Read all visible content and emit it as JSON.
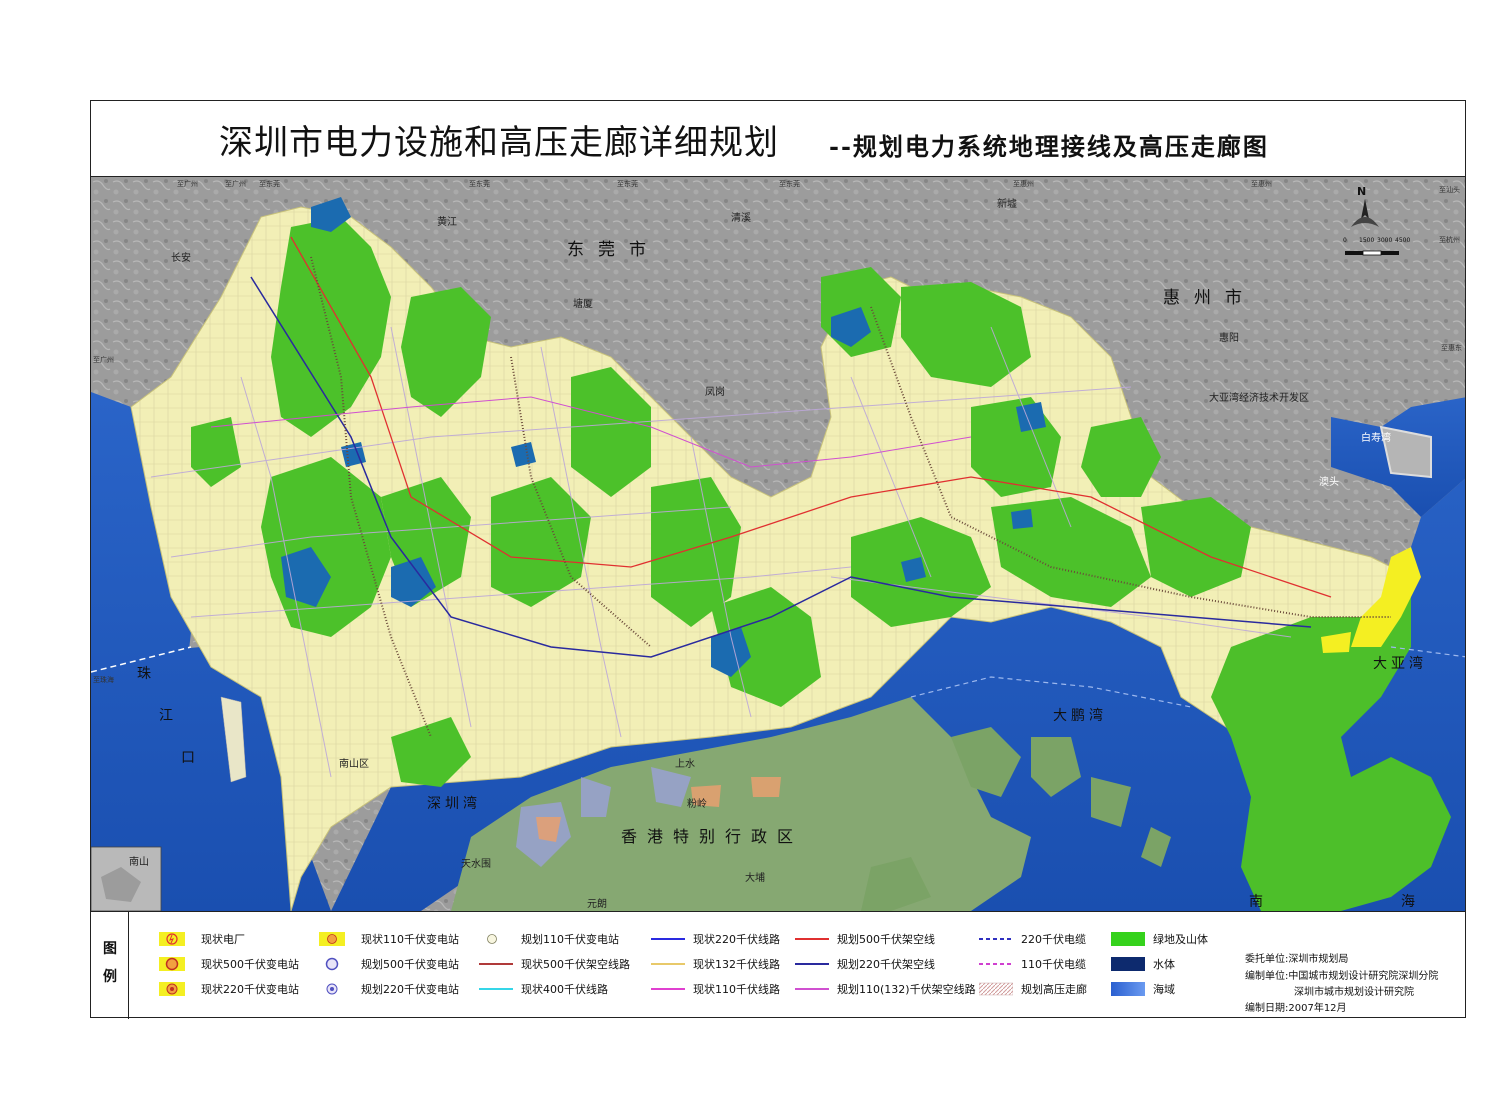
{
  "title": {
    "main": "深圳市电力设施和高压走廊详细规划",
    "sub": "--规划电力系统地理接线及高压走廊图"
  },
  "map": {
    "north_label": "N",
    "scale_labels": [
      "0",
      "1500",
      "3000",
      "4500"
    ],
    "colors": {
      "sea": "#1f5fc8",
      "land_grey": "#9a9a9a",
      "urban": "#f2efb6",
      "green": "#4dbf2a",
      "green_bright": "#35d21c",
      "water": "#1b6bb0",
      "hongkong": "#7da36a",
      "power_yellow": "#f4ef22"
    },
    "places": {
      "dongguan": "东莞市",
      "huizhou": "惠州市",
      "hongkong": "香港特别行政区",
      "zhu": "珠",
      "jiang": "江",
      "kou": "口",
      "shenzhen_bay": "深圳湾",
      "dapeng_bay": "大鹏湾",
      "daya_bay": "大亚湾",
      "nan": "南",
      "hai": "海",
      "huangjiang": "黄江",
      "qingxi": "清溪",
      "tangxia": "塘厦",
      "fenggang": "凤岗",
      "chang_an": "长安",
      "xinxu": "新墟",
      "huiyang": "惠阳",
      "daya_dev": "大亚湾经济技术开发区",
      "shangshui": "上水",
      "fenling": "粉岭",
      "tianshuiwei": "天水围",
      "yuanlang": "元朗",
      "dabu": "大埔",
      "nanshan": "南山",
      "baishou": "白寿湾",
      "ao_tou": "澳头",
      "nanshan_district": "南山区"
    },
    "road_tags": {
      "zhi_guangzhou_1": "至广州",
      "zhi_guangzhou_2": "至广州",
      "zhi_dongguan_1": "至东莞",
      "zhi_dongguan_2": "至东莞",
      "zhi_dongguan_3": "至东莞",
      "zhi_dongguan_4": "至东莞",
      "zhi_huizhou_1": "至惠州",
      "zhi_huizhou_2": "至惠州",
      "zhi_shantou": "至汕头",
      "zhi_hangzhou": "至杭州",
      "zhi_pingdong": "至惠东",
      "zhi_guangzhou_3": "至广州",
      "zhi_zhuhai": "至珠海"
    }
  },
  "legend": {
    "heading": [
      "图",
      "例"
    ],
    "items": [
      {
        "label": "现状电厂",
        "symbol": "plant"
      },
      {
        "label": "现状500千伏变电站",
        "symbol": "sub-existing-500"
      },
      {
        "label": "现状220千伏变电站",
        "symbol": "sub-existing-220"
      },
      {
        "label": "现状110千伏变电站",
        "symbol": "sub-existing-110"
      },
      {
        "label": "规划500千伏变电站",
        "symbol": "sub-planned-500"
      },
      {
        "label": "规划220千伏变电站",
        "symbol": "sub-planned-220"
      },
      {
        "label": "规划110千伏变电站",
        "symbol": "sub-planned-110"
      },
      {
        "label": "现状500千伏架空线路",
        "symbol": "line",
        "color": "#b03a3a",
        "style": "solid"
      },
      {
        "label": "现状400千伏线路",
        "symbol": "line",
        "color": "#35d6e8",
        "style": "solid"
      },
      {
        "label": "现状220千伏线路",
        "symbol": "line",
        "color": "#2a2ae0",
        "style": "solid"
      },
      {
        "label": "现状132千伏线路",
        "symbol": "line",
        "color": "#e8c96a",
        "style": "solid"
      },
      {
        "label": "现状110千伏线路",
        "symbol": "line",
        "color": "#e040d0",
        "style": "solid"
      },
      {
        "label": "规划500千伏架空线",
        "symbol": "line",
        "color": "#e03030",
        "style": "solid"
      },
      {
        "label": "规划220千伏架空线",
        "symbol": "line",
        "color": "#2a2a9e",
        "style": "solid"
      },
      {
        "label": "规划110(132)千伏架空线路",
        "symbol": "line",
        "color": "#d050d0",
        "style": "solid"
      },
      {
        "label": "220千伏电缆",
        "symbol": "line",
        "color": "#3030c0",
        "style": "dashed"
      },
      {
        "label": "110千伏电缆",
        "symbol": "line",
        "color": "#d040d0",
        "style": "dashed"
      },
      {
        "label": "规划高压走廊",
        "symbol": "corridor"
      },
      {
        "label": "绿地及山体",
        "symbol": "fill",
        "color": "#35d21c"
      },
      {
        "label": "水体",
        "symbol": "fill",
        "color": "#0d2a6e"
      },
      {
        "label": "海域",
        "symbol": "fill",
        "color": "#3a6fe0"
      }
    ],
    "info": {
      "client": "委托单位:深圳市规划局",
      "compiler1": "编制单位:中国城市规划设计研究院深圳分院",
      "compiler2": "深圳市城市规划设计研究院",
      "date": "编制日期:2007年12月"
    }
  }
}
